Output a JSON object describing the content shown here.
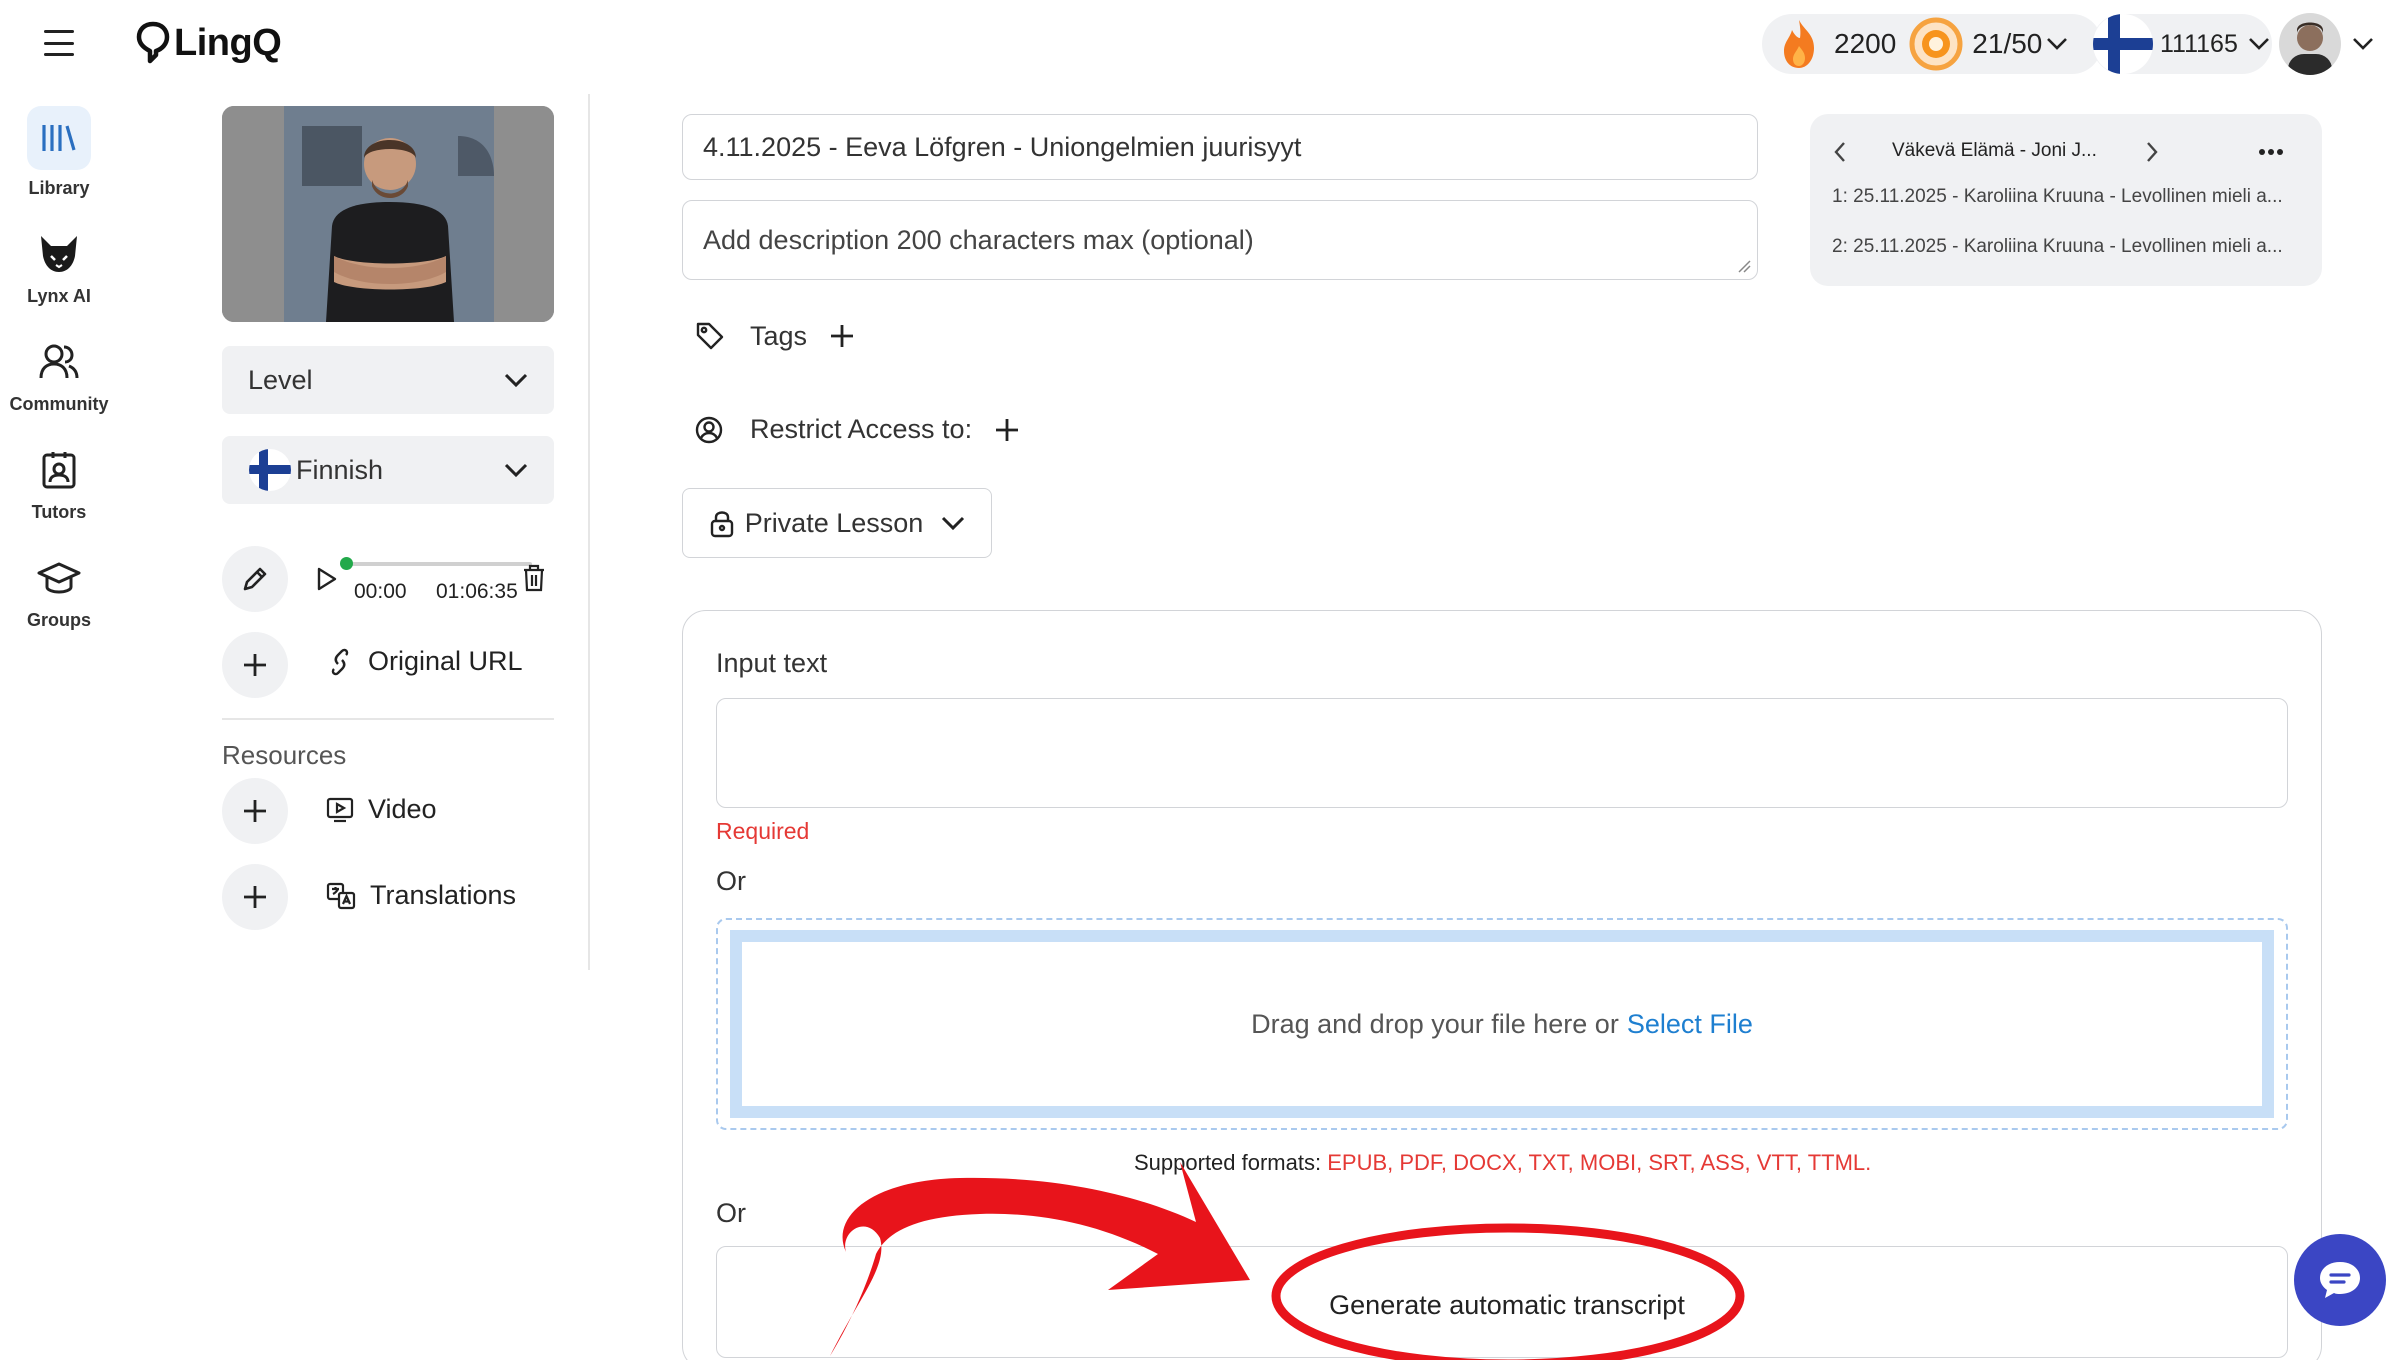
{
  "header": {
    "logo_text": "LingQ",
    "streak_count": "2200",
    "daily_goal": "21/50",
    "known_words": "111165"
  },
  "nav": {
    "items": [
      {
        "label": "Library",
        "icon": "library-icon",
        "active": true
      },
      {
        "label": "Lynx AI",
        "icon": "lynx-icon"
      },
      {
        "label": "Community",
        "icon": "community-icon"
      },
      {
        "label": "Tutors",
        "icon": "tutors-icon"
      },
      {
        "label": "Groups",
        "icon": "groups-icon"
      }
    ]
  },
  "left": {
    "level_label": "Level",
    "language_label": "Finnish",
    "audio": {
      "current_time": "00:00",
      "duration": "01:06:35",
      "progress": 0
    },
    "original_url_label": "Original URL",
    "resources_heading": "Resources",
    "video_label": "Video",
    "translations_label": "Translations"
  },
  "form": {
    "title_value": "4.11.2025 - Eeva Löfgren - Uniongelmien juurisyyt",
    "description_placeholder": "Add description 200 characters max (optional)",
    "tags_label": "Tags",
    "restrict_label": "Restrict Access to:",
    "privacy_label": "Private Lesson",
    "input_text_label": "Input text",
    "required_text": "Required",
    "or_1": "Or",
    "dropzone_text": "Drag and drop your file here or",
    "select_file_label": "Select File",
    "formats_label": "Supported formats:",
    "formats_list": "EPUB, PDF, DOCX, TXT, MOBI, SRT, ASS, VTT, TTML.",
    "or_2": "Or",
    "generate_label": "Generate automatic transcript"
  },
  "collection": {
    "title": "Väkevä Elämä - Joni J...",
    "items": [
      "1: 25.11.2025 - Karoliina Kruuna - Levollinen mieli a...",
      "2: 25.11.2025 - Karoliina Kruuna - Levollinen mieli a..."
    ]
  },
  "colors": {
    "accent_blue": "#1e7fd0",
    "error_red": "#e53935",
    "annotation_red": "#e8141b",
    "chat_button": "#3b46c4"
  }
}
